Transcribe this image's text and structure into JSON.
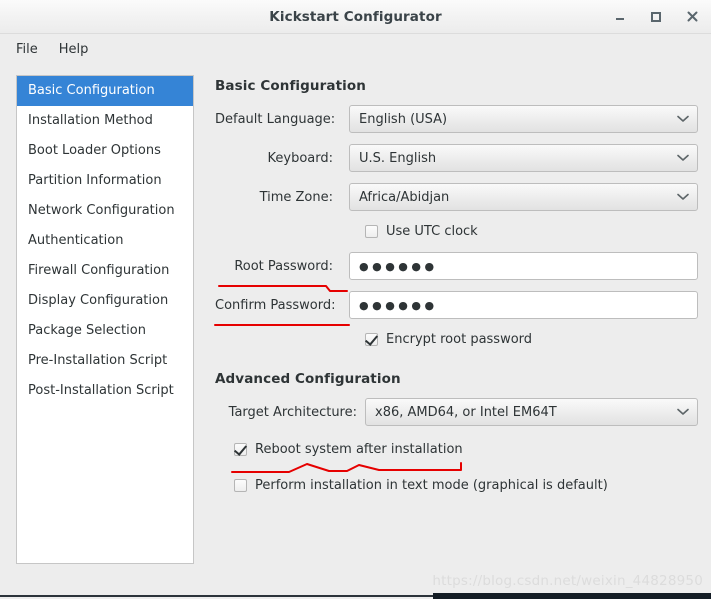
{
  "window": {
    "title": "Kickstart Configurator",
    "buttons": [
      {
        "name": "minimize",
        "label": "_"
      },
      {
        "name": "maximize",
        "label": "□"
      },
      {
        "name": "close",
        "label": "✕"
      }
    ]
  },
  "menubar": {
    "items": [
      {
        "label": "File"
      },
      {
        "label": "Help"
      }
    ]
  },
  "sidebar": {
    "items": [
      {
        "label": "Basic Configuration",
        "selected": true
      },
      {
        "label": "Installation Method",
        "selected": false
      },
      {
        "label": "Boot Loader Options",
        "selected": false
      },
      {
        "label": "Partition Information",
        "selected": false
      },
      {
        "label": "Network Configuration",
        "selected": false
      },
      {
        "label": "Authentication",
        "selected": false
      },
      {
        "label": "Firewall Configuration",
        "selected": false
      },
      {
        "label": "Display Configuration",
        "selected": false
      },
      {
        "label": "Package Selection",
        "selected": false
      },
      {
        "label": "Pre-Installation Script",
        "selected": false
      },
      {
        "label": "Post-Installation Script",
        "selected": false
      }
    ]
  },
  "main": {
    "basic": {
      "heading": "Basic Configuration",
      "language": {
        "label": "Default Language:",
        "value": "English (USA)"
      },
      "keyboard": {
        "label": "Keyboard:",
        "value": "U.S. English"
      },
      "timezone": {
        "label": "Time Zone:",
        "value": "Africa/Abidjan"
      },
      "utc": {
        "label": "Use UTC clock",
        "checked": false
      },
      "root_password": {
        "label": "Root Password:",
        "value": "●●●●●●",
        "placeholder": ""
      },
      "confirm_password": {
        "label": "Confirm Password:",
        "value": "●●●●●●",
        "placeholder": ""
      },
      "encrypt": {
        "label": "Encrypt root password",
        "checked": true
      }
    },
    "advanced": {
      "heading": "Advanced Configuration",
      "architecture": {
        "label": "Target Architecture:",
        "value": "x86, AMD64, or Intel EM64T"
      },
      "reboot": {
        "label": "Reboot system after installation",
        "checked": true
      },
      "textmode": {
        "label": "Perform installation in text mode (graphical is default)",
        "checked": false
      }
    }
  },
  "watermark": {
    "text": "https://blog.csdn.net/weixin_44828950"
  },
  "colors": {
    "accent": "#3584d6",
    "window_bg": "#ededed",
    "panel_bg": "#ffffff",
    "text": "#2e3436",
    "annotation_red": "#e60000",
    "border": "#c6c6c6"
  }
}
